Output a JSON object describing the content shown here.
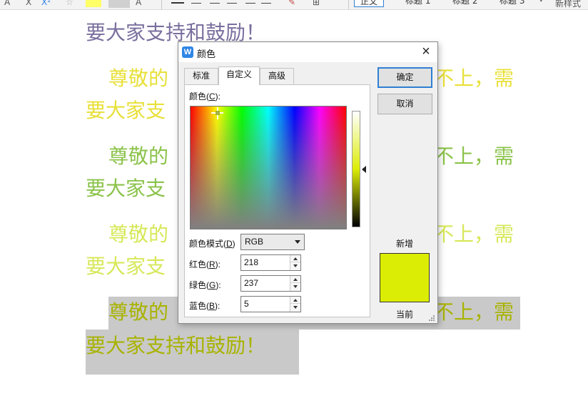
{
  "ribbon": {
    "left_glyphs": [
      "A",
      "X",
      "X²"
    ],
    "style_boxes": [
      "正文",
      "标题 1",
      "标题 2",
      "标题 3"
    ],
    "new_style": "新样式"
  },
  "document": {
    "line1": "要大家支持和鼓励！",
    "p1": {
      "left": "尊敬的",
      "right": "不上，需",
      "cont": "要大家支"
    },
    "p2": {
      "left": "尊敬的",
      "right": "不上，需",
      "cont": "要大家支"
    },
    "p3": {
      "left": "尊敬的",
      "right": "不上，需",
      "cont": "要大家支"
    },
    "p4": {
      "left": "尊敬的",
      "right": "不上，需",
      "cont": "要大家支持和鼓励！"
    },
    "colors": {
      "line1": "#7a6f9e",
      "p1": "#e8e03a",
      "p2": "#8bc34a",
      "p3": "#d7e85a",
      "p4": "#a8b300",
      "selection": "#c9c9c9"
    }
  },
  "dialog": {
    "app_icon": "W",
    "title": "颜色",
    "close_icon": "×",
    "tabs": [
      {
        "label": "标准",
        "active": false
      },
      {
        "label": "自定义",
        "active": true
      },
      {
        "label": "高级",
        "active": false
      }
    ],
    "color_label": "颜色(",
    "color_key": "C",
    "color_label_end": "):",
    "mode_label": "颜色模式(",
    "mode_key": "D",
    "mode_label_end": ")",
    "mode_value": "RGB",
    "red_label": "红色(",
    "red_key": "R",
    "red_label_end": "):",
    "red_value": "218",
    "green_label": "绿色(",
    "green_key": "G",
    "green_label_end": "):",
    "green_value": "237",
    "blue_label": "蓝色(",
    "blue_key": "B",
    "blue_label_end": "):",
    "blue_value": "5",
    "ok_button": "确定",
    "cancel_button": "取消",
    "new_label": "新增",
    "current_label": "当前",
    "preview_color": "#dced05"
  }
}
